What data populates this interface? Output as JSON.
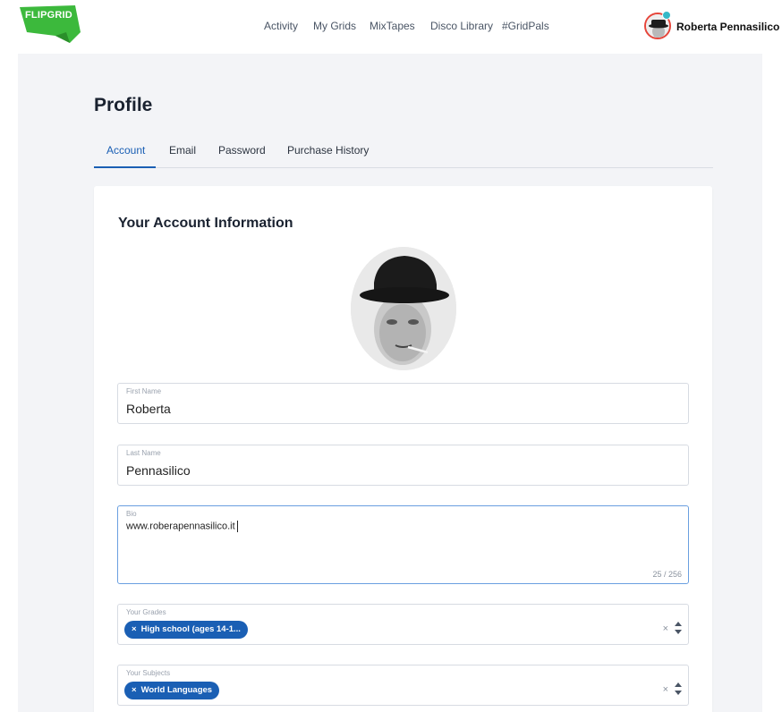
{
  "logo": {
    "text": "FLIPGRID",
    "color": "#3cb93c"
  },
  "nav": {
    "items": [
      {
        "label": "Activity"
      },
      {
        "label": "My Grids"
      },
      {
        "label": "MixTapes"
      },
      {
        "label": "Disco Library"
      },
      {
        "label": "#GridPals"
      }
    ]
  },
  "user": {
    "name": "Roberta Pennasilico",
    "avatar_icon": "user-avatar-icon"
  },
  "page": {
    "title": "Profile",
    "tabs": [
      {
        "label": "Account",
        "active": true
      },
      {
        "label": "Email",
        "active": false
      },
      {
        "label": "Password",
        "active": false
      },
      {
        "label": "Purchase History",
        "active": false
      }
    ]
  },
  "card": {
    "title": "Your Account Information",
    "photo_icon": "profile-photo-icon",
    "first_name": {
      "label": "First Name",
      "value": "Roberta"
    },
    "last_name": {
      "label": "Last Name",
      "value": "Pennasilico"
    },
    "bio": {
      "label": "Bio",
      "value": "www.roberapennasilico.it",
      "counter": "25 / 256"
    },
    "grades": {
      "label": "Your Grades",
      "chip": "High school (ages 14-1...",
      "chip_remove": "×",
      "clear": "×"
    },
    "subjects": {
      "label": "Your Subjects",
      "chip": "World Languages",
      "chip_remove": "×",
      "clear": "×"
    }
  },
  "colors": {
    "accent": "#1a5fb4",
    "page_bg": "#f3f4f7",
    "brand_green": "#3cb93c"
  }
}
